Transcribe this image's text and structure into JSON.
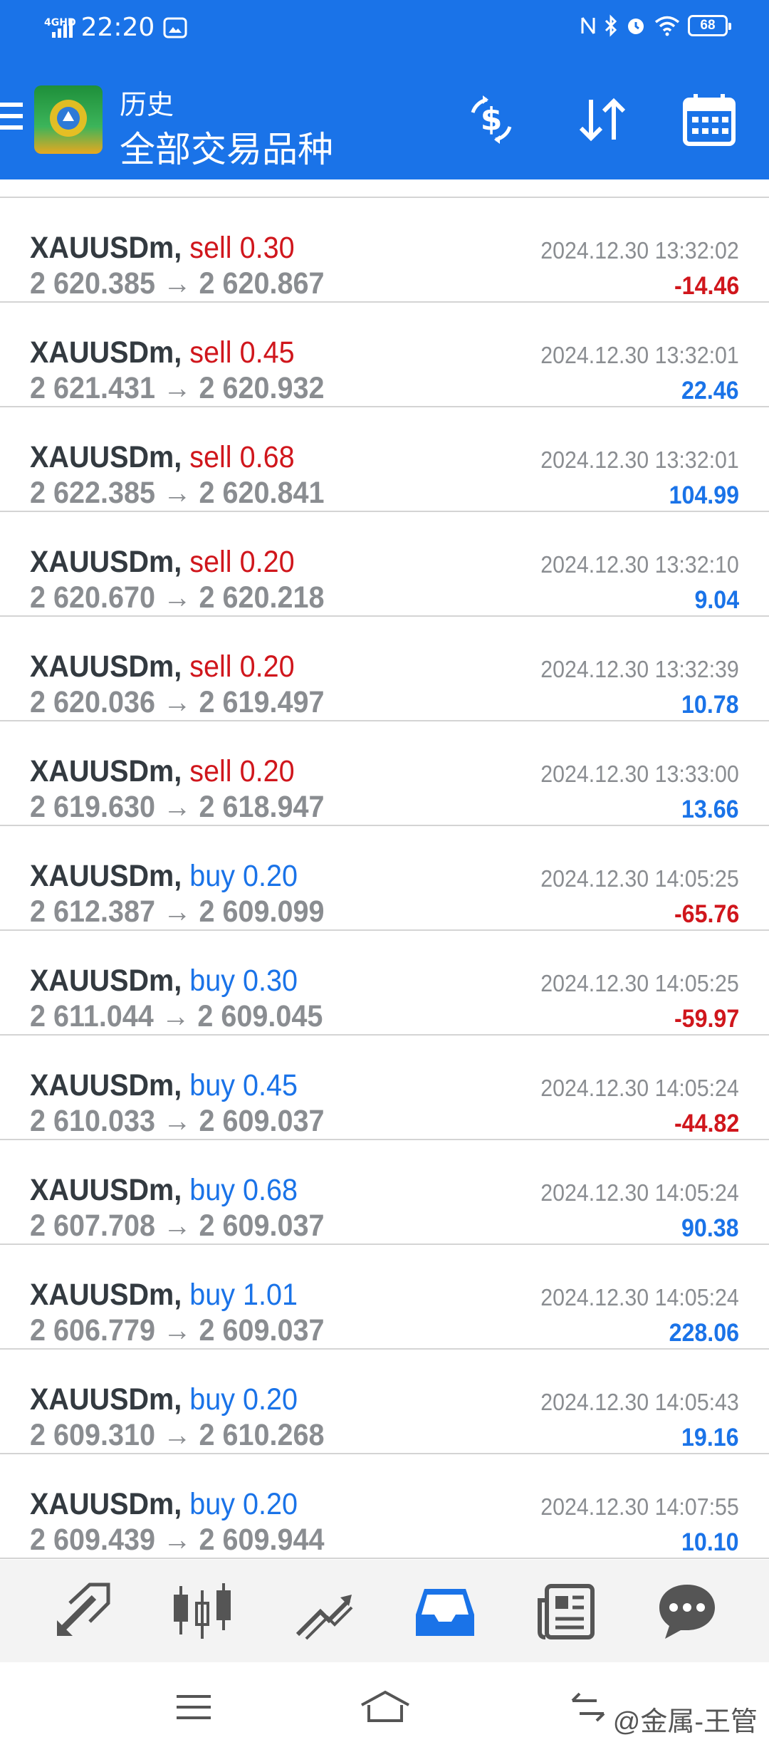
{
  "status_bar": {
    "network": "4GHD",
    "time": "22:20",
    "battery": "68"
  },
  "header": {
    "title": "历史",
    "subtitle": "全部交易品种"
  },
  "trades": [
    {
      "symbol": "XAUUSDm,",
      "side": "sell",
      "volume": "0.30",
      "open": "2 620.385",
      "close": "2 620.867",
      "time": "2024.12.30 13:32:02",
      "profit": "-14.46"
    },
    {
      "symbol": "XAUUSDm,",
      "side": "sell",
      "volume": "0.45",
      "open": "2 621.431",
      "close": "2 620.932",
      "time": "2024.12.30 13:32:01",
      "profit": "22.46"
    },
    {
      "symbol": "XAUUSDm,",
      "side": "sell",
      "volume": "0.68",
      "open": "2 622.385",
      "close": "2 620.841",
      "time": "2024.12.30 13:32:01",
      "profit": "104.99"
    },
    {
      "symbol": "XAUUSDm,",
      "side": "sell",
      "volume": "0.20",
      "open": "2 620.670",
      "close": "2 620.218",
      "time": "2024.12.30 13:32:10",
      "profit": "9.04"
    },
    {
      "symbol": "XAUUSDm,",
      "side": "sell",
      "volume": "0.20",
      "open": "2 620.036",
      "close": "2 619.497",
      "time": "2024.12.30 13:32:39",
      "profit": "10.78"
    },
    {
      "symbol": "XAUUSDm,",
      "side": "sell",
      "volume": "0.20",
      "open": "2 619.630",
      "close": "2 618.947",
      "time": "2024.12.30 13:33:00",
      "profit": "13.66"
    },
    {
      "symbol": "XAUUSDm,",
      "side": "buy",
      "volume": "0.20",
      "open": "2 612.387",
      "close": "2 609.099",
      "time": "2024.12.30 14:05:25",
      "profit": "-65.76"
    },
    {
      "symbol": "XAUUSDm,",
      "side": "buy",
      "volume": "0.30",
      "open": "2 611.044",
      "close": "2 609.045",
      "time": "2024.12.30 14:05:25",
      "profit": "-59.97"
    },
    {
      "symbol": "XAUUSDm,",
      "side": "buy",
      "volume": "0.45",
      "open": "2 610.033",
      "close": "2 609.037",
      "time": "2024.12.30 14:05:24",
      "profit": "-44.82"
    },
    {
      "symbol": "XAUUSDm,",
      "side": "buy",
      "volume": "0.68",
      "open": "2 607.708",
      "close": "2 609.037",
      "time": "2024.12.30 14:05:24",
      "profit": "90.38"
    },
    {
      "symbol": "XAUUSDm,",
      "side": "buy",
      "volume": "1.01",
      "open": "2 606.779",
      "close": "2 609.037",
      "time": "2024.12.30 14:05:24",
      "profit": "228.06"
    },
    {
      "symbol": "XAUUSDm,",
      "side": "buy",
      "volume": "0.20",
      "open": "2 609.310",
      "close": "2 610.268",
      "time": "2024.12.30 14:05:43",
      "profit": "19.16"
    },
    {
      "symbol": "XAUUSDm,",
      "side": "buy",
      "volume": "0.20",
      "open": "2 609.439",
      "close": "2 609.944",
      "time": "2024.12.30 14:07:55",
      "profit": "10.10"
    }
  ],
  "arrow_glyph": "→",
  "tabs": [
    {
      "icon": "quotes-icon",
      "active": false
    },
    {
      "icon": "chart-icon",
      "active": false
    },
    {
      "icon": "trade-icon",
      "active": false
    },
    {
      "icon": "history-icon",
      "active": true
    },
    {
      "icon": "news-icon",
      "active": false
    },
    {
      "icon": "chat-icon",
      "active": false
    }
  ],
  "watermark": "@金属-王管",
  "colors": {
    "primary": "#1a73e8",
    "sell": "#d0161c",
    "loss": "#d0161c",
    "gain": "#1a73e8",
    "muted": "#8a8d91"
  }
}
